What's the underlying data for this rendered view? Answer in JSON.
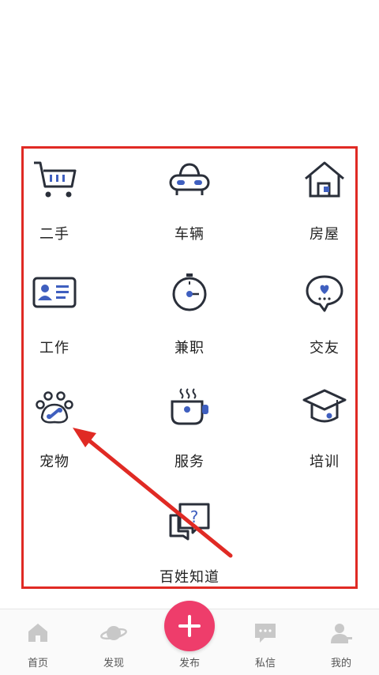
{
  "categories": [
    {
      "key": "secondhand",
      "label": "二手",
      "icon": "shopping-cart-icon"
    },
    {
      "key": "vehicles",
      "label": "车辆",
      "icon": "car-icon"
    },
    {
      "key": "housing",
      "label": "房屋",
      "icon": "house-icon"
    },
    {
      "key": "jobs",
      "label": "工作",
      "icon": "id-card-icon"
    },
    {
      "key": "parttime",
      "label": "兼职",
      "icon": "stopwatch-icon"
    },
    {
      "key": "friends",
      "label": "交友",
      "icon": "heart-chat-icon"
    },
    {
      "key": "pets",
      "label": "宠物",
      "icon": "paw-icon"
    },
    {
      "key": "services",
      "label": "服务",
      "icon": "coffee-cup-icon"
    },
    {
      "key": "training",
      "label": "培训",
      "icon": "graduation-cap-icon"
    },
    {
      "key": "qa",
      "label": "百姓知道",
      "icon": "question-chat-icon"
    }
  ],
  "tabbar": {
    "home": "首页",
    "discover": "发现",
    "publish": "发布",
    "messages": "私信",
    "profile": "我的"
  },
  "colors": {
    "accent_blue": "#3f5fbf",
    "icon_stroke": "#2a2f3a",
    "publish_pink": "#ee3d6b",
    "annotation_red": "#e02a24"
  }
}
